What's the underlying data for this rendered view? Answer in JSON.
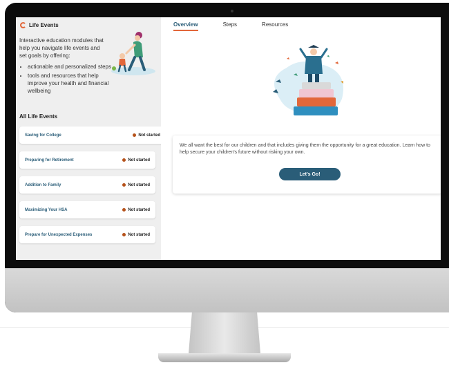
{
  "sidebar": {
    "title": "Life Events",
    "intro": "Interactive education modules that help you navigate life events and set goals by offering:",
    "bullets": [
      "actionable and personalized steps",
      "tools and resources that help improve your health and financial wellbeing"
    ],
    "section_title": "All Life Events",
    "events": [
      {
        "label": "Saving for College",
        "status": "Not started"
      },
      {
        "label": "Preparing for Retirement",
        "status": "Not started"
      },
      {
        "label": "Addition to Family",
        "status": "Not started"
      },
      {
        "label": "Maximizing Your HSA",
        "status": "Not started"
      },
      {
        "label": "Prepare for Unexpected Expenses",
        "status": "Not started"
      }
    ]
  },
  "tabs": [
    "Overview",
    "Steps",
    "Resources"
  ],
  "card": {
    "text": "We all want the best for our children and that includes giving them the opportunity for a great education. Learn how to help secure your children's future without risking your own.",
    "cta": "Let's Go!"
  },
  "colors": {
    "accent": "#e2673a",
    "primary": "#2a5d78",
    "status_dot": "#b5521b"
  }
}
